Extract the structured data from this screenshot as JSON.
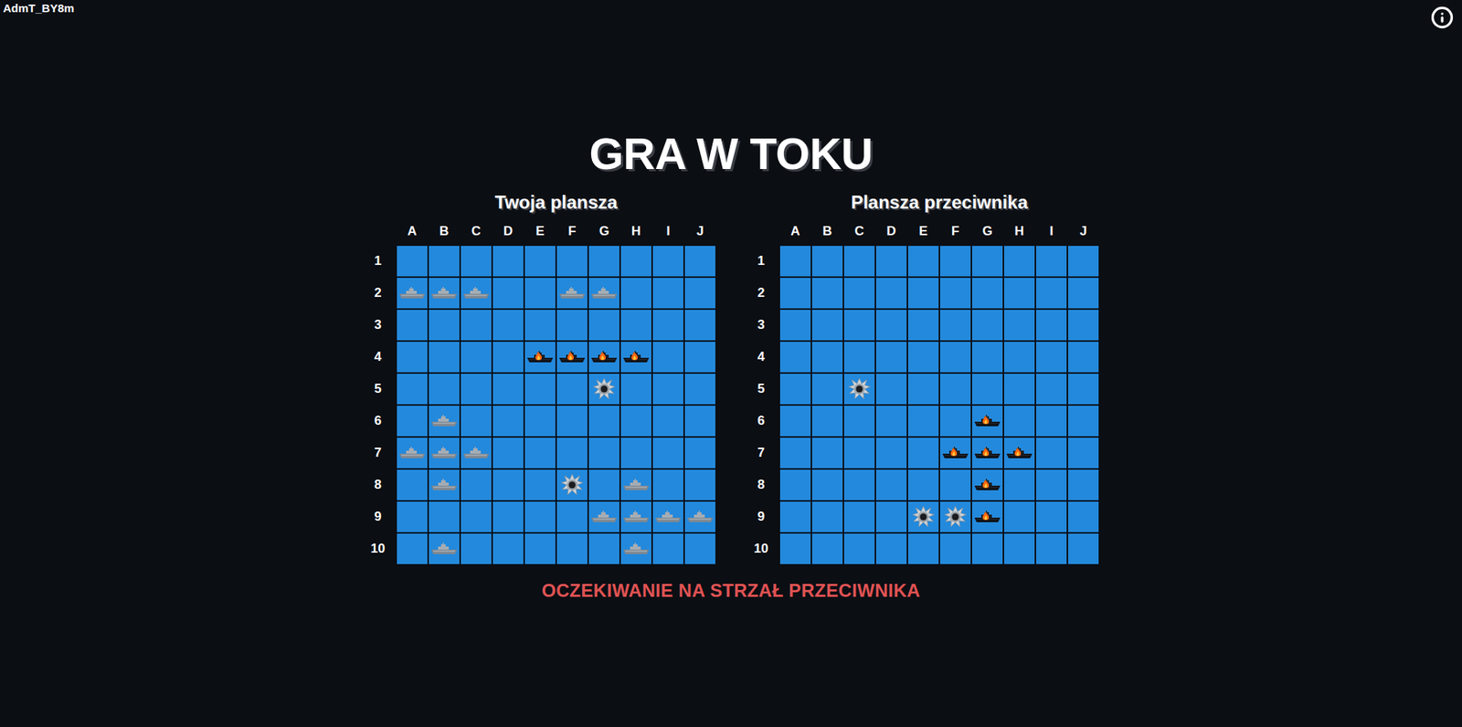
{
  "header": {
    "username": "AdmT_BY8m"
  },
  "title": "GRA W TOKU",
  "boards": [
    {
      "title": "Twoja plansza",
      "columns": [
        "A",
        "B",
        "C",
        "D",
        "E",
        "F",
        "G",
        "H",
        "I",
        "J"
      ],
      "rows": [
        {
          "label": "1",
          "cells": [
            "empty",
            "empty",
            "empty",
            "empty",
            "empty",
            "empty",
            "empty",
            "empty",
            "empty",
            "empty"
          ]
        },
        {
          "label": "2",
          "cells": [
            "ship",
            "ship",
            "ship",
            "empty",
            "empty",
            "ship",
            "ship",
            "empty",
            "empty",
            "empty"
          ]
        },
        {
          "label": "3",
          "cells": [
            "empty",
            "empty",
            "empty",
            "empty",
            "empty",
            "empty",
            "empty",
            "empty",
            "empty",
            "empty"
          ]
        },
        {
          "label": "4",
          "cells": [
            "empty",
            "empty",
            "empty",
            "empty",
            "hit",
            "hit",
            "hit",
            "hit",
            "empty",
            "empty"
          ]
        },
        {
          "label": "5",
          "cells": [
            "empty",
            "empty",
            "empty",
            "empty",
            "empty",
            "empty",
            "miss",
            "empty",
            "empty",
            "empty"
          ]
        },
        {
          "label": "6",
          "cells": [
            "empty",
            "ship",
            "empty",
            "empty",
            "empty",
            "empty",
            "empty",
            "empty",
            "empty",
            "empty"
          ]
        },
        {
          "label": "7",
          "cells": [
            "ship",
            "ship",
            "ship",
            "empty",
            "empty",
            "empty",
            "empty",
            "empty",
            "empty",
            "empty"
          ]
        },
        {
          "label": "8",
          "cells": [
            "empty",
            "ship",
            "empty",
            "empty",
            "empty",
            "miss",
            "empty",
            "ship",
            "empty",
            "empty"
          ]
        },
        {
          "label": "9",
          "cells": [
            "empty",
            "empty",
            "empty",
            "empty",
            "empty",
            "empty",
            "ship",
            "ship",
            "ship",
            "ship"
          ]
        },
        {
          "label": "10",
          "cells": [
            "empty",
            "ship",
            "empty",
            "empty",
            "empty",
            "empty",
            "empty",
            "ship",
            "empty",
            "empty"
          ]
        }
      ]
    },
    {
      "title": "Plansza przeciwnika",
      "columns": [
        "A",
        "B",
        "C",
        "D",
        "E",
        "F",
        "G",
        "H",
        "I",
        "J"
      ],
      "rows": [
        {
          "label": "1",
          "cells": [
            "empty",
            "empty",
            "empty",
            "empty",
            "empty",
            "empty",
            "empty",
            "empty",
            "empty",
            "empty"
          ]
        },
        {
          "label": "2",
          "cells": [
            "empty",
            "empty",
            "empty",
            "empty",
            "empty",
            "empty",
            "empty",
            "empty",
            "empty",
            "empty"
          ]
        },
        {
          "label": "3",
          "cells": [
            "empty",
            "empty",
            "empty",
            "empty",
            "empty",
            "empty",
            "empty",
            "empty",
            "empty",
            "empty"
          ]
        },
        {
          "label": "4",
          "cells": [
            "empty",
            "empty",
            "empty",
            "empty",
            "empty",
            "empty",
            "empty",
            "empty",
            "empty",
            "empty"
          ]
        },
        {
          "label": "5",
          "cells": [
            "empty",
            "empty",
            "miss",
            "empty",
            "empty",
            "empty",
            "empty",
            "empty",
            "empty",
            "empty"
          ]
        },
        {
          "label": "6",
          "cells": [
            "empty",
            "empty",
            "empty",
            "empty",
            "empty",
            "empty",
            "hit",
            "empty",
            "empty",
            "empty"
          ]
        },
        {
          "label": "7",
          "cells": [
            "empty",
            "empty",
            "empty",
            "empty",
            "empty",
            "hit",
            "hit",
            "hit",
            "empty",
            "empty"
          ]
        },
        {
          "label": "8",
          "cells": [
            "empty",
            "empty",
            "empty",
            "empty",
            "empty",
            "empty",
            "hit",
            "empty",
            "empty",
            "empty"
          ]
        },
        {
          "label": "9",
          "cells": [
            "empty",
            "empty",
            "empty",
            "empty",
            "miss",
            "miss",
            "hit",
            "empty",
            "empty",
            "empty"
          ]
        },
        {
          "label": "10",
          "cells": [
            "empty",
            "empty",
            "empty",
            "empty",
            "empty",
            "empty",
            "empty",
            "empty",
            "empty",
            "empty"
          ]
        }
      ]
    }
  ],
  "status": "OCZEKIWANIE NA STRZAŁ PRZECIWNIKA"
}
